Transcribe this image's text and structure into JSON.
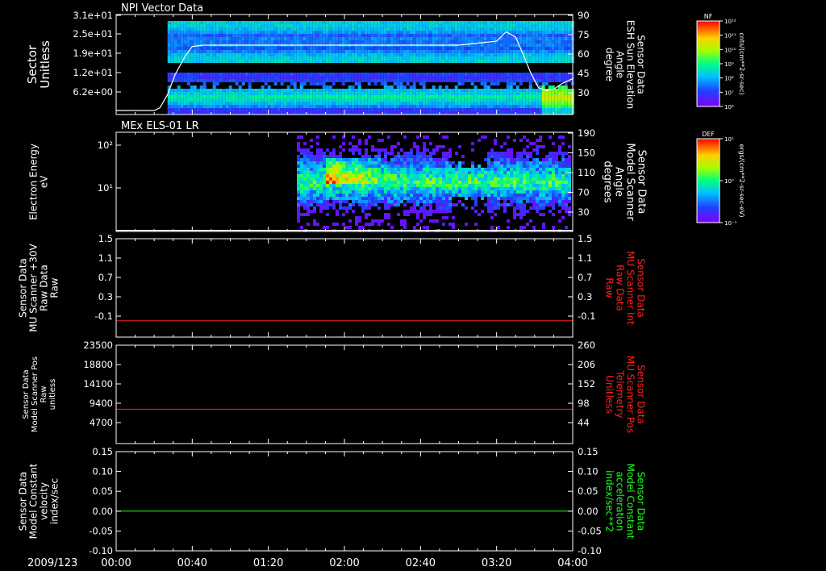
{
  "colors": {
    "background": "#000000",
    "axis": "#ffffff",
    "red_trace": "#ff2020",
    "green_trace": "#20ff20",
    "white_trace": "#ffffff"
  },
  "time_axis": {
    "date_label": "2009/123",
    "ticks": [
      "00:00",
      "00:40",
      "01:20",
      "02:00",
      "02:40",
      "03:20",
      "04:00"
    ],
    "range_minutes": [
      0,
      240
    ]
  },
  "colorbars": [
    {
      "tag": "NF",
      "unit": "cnts/(cm**2-sr-sec)",
      "tick_labels": [
        "10¹²",
        "10¹¹",
        "10¹⁰",
        "10⁹",
        "10⁸",
        "10⁷",
        "10⁶"
      ],
      "scale": "log"
    },
    {
      "tag": "DEF",
      "unit": "ergs/(cm**2-sr-sec-eV)",
      "tick_labels": [
        "10¹",
        "10⁰",
        "10⁻¹"
      ],
      "scale": "log"
    }
  ],
  "chart_data": [
    {
      "type": "heatmap",
      "title": "NPI Vector Data",
      "ylabel": [
        "Sector",
        "Unitless"
      ],
      "y_ticks": [
        "3.1e+01",
        "2.5e+01",
        "1.9e+01",
        "1.2e+01",
        "6.2e+00"
      ],
      "y2label": [
        "Sensor Data",
        "ESH Sun Elevation",
        "Angle",
        "degree"
      ],
      "y2_ticks": [
        "90",
        "75",
        "60",
        "45",
        "30"
      ],
      "y2lim": [
        15,
        90
      ],
      "data_start_minutes": 27,
      "overlay_line": {
        "name": "ESH Sun Elevation Angle",
        "x_minutes": [
          0,
          20,
          23,
          27,
          31,
          36,
          40,
          46,
          60,
          100,
          180,
          200,
          205,
          210,
          214,
          218,
          222,
          226,
          230,
          234,
          240
        ],
        "y": [
          18,
          18,
          20,
          30,
          45,
          58,
          66,
          67,
          67,
          67,
          67,
          70,
          77,
          73,
          60,
          46,
          35,
          33,
          34,
          38,
          42
        ]
      }
    },
    {
      "type": "heatmap",
      "title": "MEx ELS-01 LR",
      "ylabel": [
        "Electron Energy",
        "eV"
      ],
      "y_ticks": [
        "10²",
        "10¹"
      ],
      "y2label": [
        "Sensor Data",
        "Model Scanner",
        "Angle",
        "degrees"
      ],
      "y2_ticks": [
        "190",
        "150",
        "110",
        "70",
        "30"
      ],
      "y2lim": [
        10,
        190
      ],
      "data_start_minutes": 95,
      "overlay_line": {
        "name": "Model Scanner Angle",
        "x_minutes": [
          0,
          240
        ],
        "y": [
          12,
          12
        ]
      }
    },
    {
      "type": "line",
      "ylabel": [
        "Sensor Data",
        "MU Scanner +30V",
        "Raw Data",
        "Raw"
      ],
      "y_ticks": [
        "1.5",
        "1.1",
        "0.7",
        "0.3",
        "-0.1"
      ],
      "ylim": [
        -0.3,
        1.5
      ],
      "y2label": [
        "Sensor Data",
        "MU Scanner Int",
        "Raw Data",
        "Raw"
      ],
      "y2_ticks": [
        "1.5",
        "1.1",
        "0.7",
        "0.3",
        "-0.1"
      ],
      "series": [
        {
          "x_minutes": [
            0,
            240
          ],
          "values": [
            0.0,
            0.0
          ]
        }
      ]
    },
    {
      "type": "line",
      "ylabel": [
        "Sensor Data",
        "Model Scanner Pos",
        "Raw",
        "unitless"
      ],
      "y_ticks": [
        "23500",
        "18800",
        "14100",
        "9400",
        "4700"
      ],
      "ylim": [
        0,
        23500
      ],
      "y2label": [
        "Sensor Data",
        "MU Scanner Pos",
        "Telemetry",
        "Unitless"
      ],
      "y2_ticks": [
        "260",
        "206",
        "152",
        "98",
        "44"
      ],
      "series": [
        {
          "x_minutes": [
            0,
            240
          ],
          "values": [
            8200,
            8200
          ]
        }
      ]
    },
    {
      "type": "line",
      "ylabel": [
        "Sensor Data",
        "Model Constant",
        "velocity",
        "index/sec"
      ],
      "y_ticks": [
        "0.15",
        "0.10",
        "0.05",
        "0.00",
        "-0.05",
        "-0.10"
      ],
      "ylim": [
        -0.1,
        0.15
      ],
      "y2label": [
        "Sensor Data",
        "Model Constant",
        "acceleration",
        "index/sec**2"
      ],
      "y2_ticks": [
        "0.15",
        "0.10",
        "0.05",
        "0.00",
        "-0.05",
        "-0.10"
      ],
      "series": [
        {
          "x_minutes": [
            0,
            240
          ],
          "values": [
            0.0,
            0.0
          ]
        }
      ]
    }
  ]
}
